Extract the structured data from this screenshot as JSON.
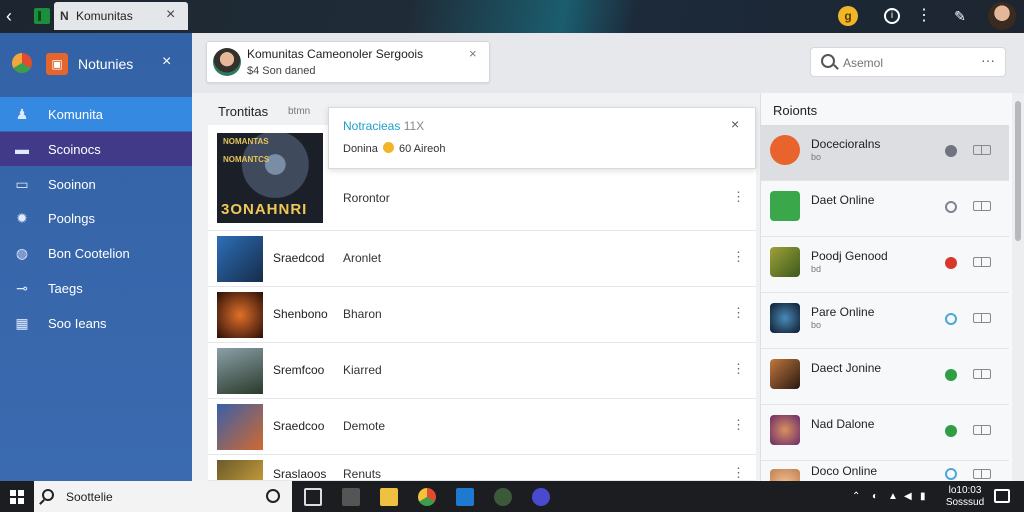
{
  "titlebar": {
    "tab_title": "Komunitas",
    "back_icon": "arrow-left-icon",
    "close_icon": "close-icon"
  },
  "sidebar": {
    "title": "Notunies",
    "items": [
      {
        "label": "Komunita",
        "icon": "people-icon",
        "state": "active"
      },
      {
        "label": "Scoinocs",
        "icon": "list-icon",
        "state": "highlighted"
      },
      {
        "label": "Sooinon",
        "icon": "chat-icon",
        "state": "normal"
      },
      {
        "label": "Poolngs",
        "icon": "gear-icon",
        "state": "normal"
      },
      {
        "label": "Bon Cootelion",
        "icon": "globe-icon",
        "state": "normal"
      },
      {
        "label": "Taegs",
        "icon": "tag-icon",
        "state": "normal"
      },
      {
        "label": "Soo Ieans",
        "icon": "grid-icon",
        "state": "normal"
      }
    ]
  },
  "notification": {
    "title": "Komunitas Cameonoler Sergoois",
    "subtitle": "$4 Son daned"
  },
  "search": {
    "placeholder": "Asemol"
  },
  "main": {
    "title": "Trontitas",
    "title_sub": "btmn",
    "featured": {
      "thumb_top": "NOMANTAS",
      "thumb_mid": "NOMANTCS",
      "thumb_text": "3ONAHNRI",
      "status": "Rorontor"
    },
    "rows": [
      {
        "name": "Sraedcod",
        "status": "Aronlet",
        "color": "#2d6fb8"
      },
      {
        "name": "Shenbono",
        "status": "Bharon",
        "color": "#b8431e"
      },
      {
        "name": "Sremfcoo",
        "status": "Kiarred",
        "color": "#3b5a3a"
      },
      {
        "name": "Sraedcoo",
        "status": "Demote",
        "color": "#3a5fa8"
      },
      {
        "name": "Sraslaoos",
        "status": "Renuts",
        "color": "#6b5a2a"
      }
    ]
  },
  "popup": {
    "title": "Notracieas",
    "title_suffix": "11X",
    "body_prefix": "Donina",
    "body_suffix": "60 Aireoh"
  },
  "right_panel": {
    "title": "Roionts",
    "items": [
      {
        "name": "Docecioralns",
        "sub": "bo",
        "status_color": "#6f7480",
        "avatar": "#e8642c",
        "selected": true
      },
      {
        "name": "Daet Online",
        "sub": "",
        "status_color": "#7e8590",
        "avatar": "#3aa84a",
        "selected": false
      },
      {
        "name": "Poodj Genood",
        "sub": "bd",
        "status_color": "#d7372c",
        "avatar": "#5b6f2a",
        "selected": false
      },
      {
        "name": "Pare Online",
        "sub": "bo",
        "status_color": "#49a8d8",
        "avatar": "#1f3a5c",
        "selected": false
      },
      {
        "name": "Daect Jonine",
        "sub": "",
        "status_color": "#2f9e44",
        "avatar": "#7a4a30",
        "selected": false
      },
      {
        "name": "Nad Dalone",
        "sub": "",
        "status_color": "#2f9e44",
        "avatar": "#8a3a8a",
        "selected": false
      },
      {
        "name": "Doco Online",
        "sub": "",
        "status_color": "#49a8d8",
        "avatar": "#d8a070",
        "selected": false
      }
    ]
  },
  "taskbar": {
    "search_text": "Soottelie",
    "time": "lo10:03",
    "date": "Sosssud"
  },
  "colors": {
    "sidebar": "#3462a6",
    "active": "#3589e0",
    "highlight": "#403a88",
    "accent": "#1e9ec8"
  }
}
